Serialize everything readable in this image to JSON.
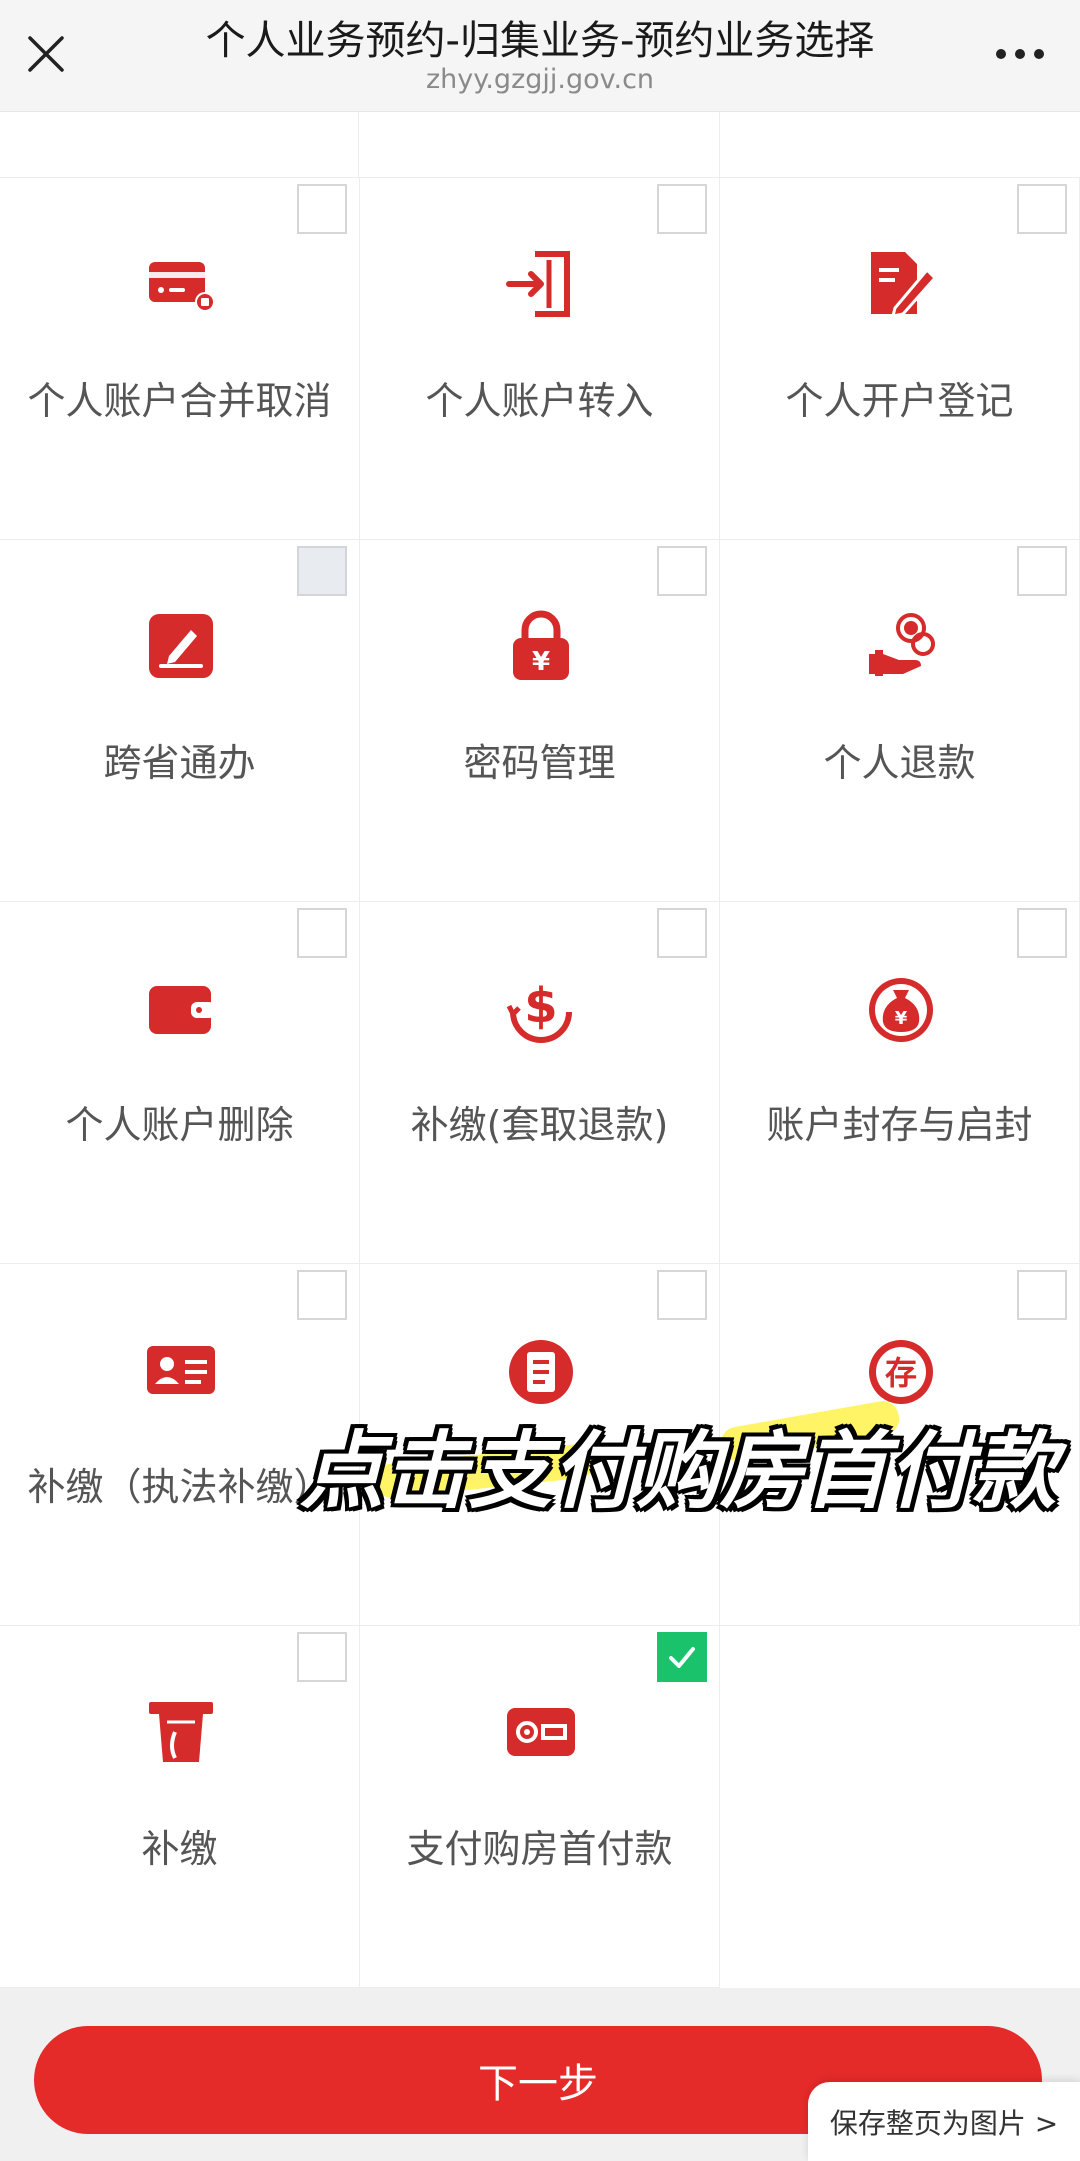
{
  "header": {
    "title": "个人业务预约-归集业务-预约业务选择",
    "url": "zhyy.gzgjj.gov.cn"
  },
  "colors": {
    "accent": "#d52b2b",
    "check": "#19c26b",
    "button": "#e52a2a"
  },
  "services": [
    {
      "label": "个人账户合并取消",
      "icon": "card-icon",
      "checked": false
    },
    {
      "label": "个人账户转入",
      "icon": "transfer-in-icon",
      "checked": false
    },
    {
      "label": "个人开户登记",
      "icon": "document-edit-icon",
      "checked": false
    },
    {
      "label": "跨省通办",
      "icon": "pen-square-icon",
      "checked": false
    },
    {
      "label": "密码管理",
      "icon": "lock-yuan-icon",
      "checked": false
    },
    {
      "label": "个人退款",
      "icon": "hand-coins-icon",
      "checked": false
    },
    {
      "label": "个人账户删除",
      "icon": "wallet-icon",
      "checked": false
    },
    {
      "label": "补缴(套取退款)",
      "icon": "dollar-refresh-icon",
      "checked": false
    },
    {
      "label": "账户封存与启封",
      "icon": "money-bag-icon",
      "checked": false
    },
    {
      "label": "补缴（执法补缴）",
      "icon": "id-card-icon",
      "checked": false
    },
    {
      "label": "",
      "icon": "clipboard-icon",
      "checked": false
    },
    {
      "label": "",
      "icon": "deposit-icon",
      "checked": false
    },
    {
      "label": "补缴",
      "icon": "atm-icon",
      "checked": false
    },
    {
      "label": "支付购房首付款",
      "icon": "payment-card-icon",
      "checked": true
    }
  ],
  "caption": "点击支付购房首付款",
  "buttons": {
    "next": "下一步",
    "save_page": "保存整页为图片 >"
  },
  "icon_glyphs": {
    "clipboard_text": "☰",
    "deposit_text": "存",
    "yuan": "¥"
  }
}
